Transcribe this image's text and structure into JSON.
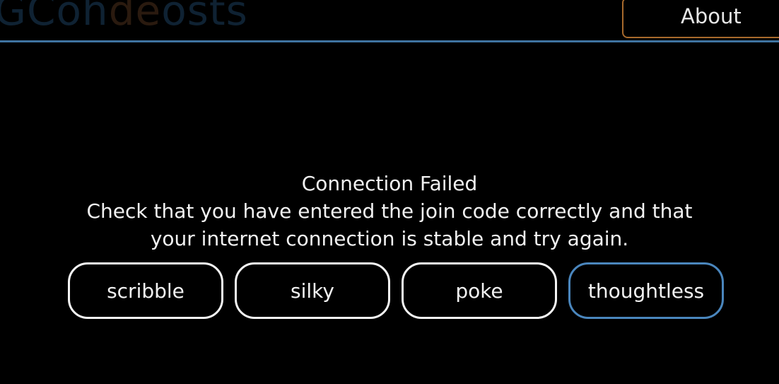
{
  "header": {
    "logo_part1": "GCoh",
    "logo_part2": "de",
    "logo_part3": "osts",
    "about_label": "About",
    "accent_color": "#3f73a0",
    "about_border_color": "#a86a2c"
  },
  "message": {
    "title": "Connection Failed",
    "line1": "Check that you have entered the join code correctly and that",
    "line2": "your internet connection is stable and try again."
  },
  "join_code": {
    "words": [
      "scribble",
      "silky",
      "poke",
      "thoughtless"
    ],
    "active_color": "#4a86bd"
  }
}
